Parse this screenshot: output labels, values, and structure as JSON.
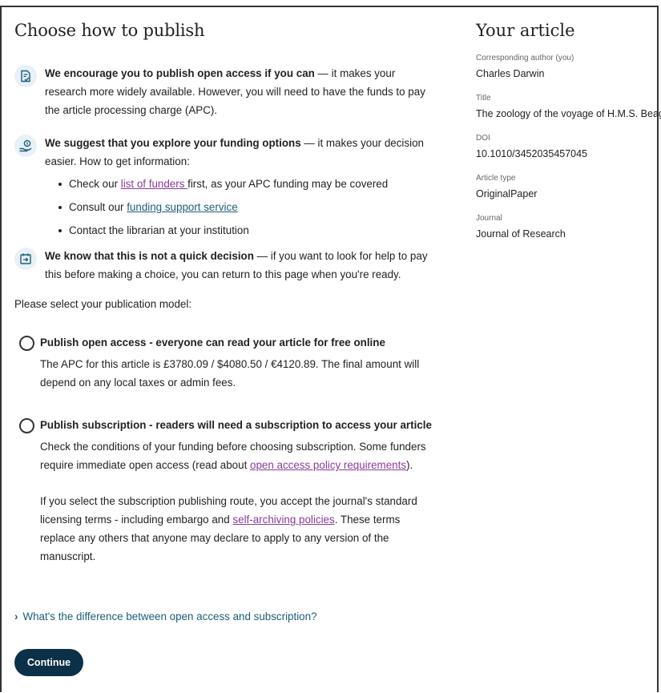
{
  "main": {
    "title": "Choose how to publish",
    "info": [
      {
        "icon": "document-check-icon",
        "bold": "We encourage you to publish open access if you can",
        "rest": " — it makes your research more widely available. However, you will need to have the funds to pay the article processing charge (APC)."
      },
      {
        "icon": "funding-hand-icon",
        "bold": "We suggest that you explore your funding options",
        "rest": " — it makes your decision easier. How to get information:",
        "bullets": {
          "b1_pre": "Check our ",
          "b1_link": "list of funders ",
          "b1_post": "first, as your APC funding may be covered",
          "b2_pre": "Consult our ",
          "b2_link": "funding support service",
          "b3": "Contact the librarian at your institution"
        }
      },
      {
        "icon": "calendar-arrow-icon",
        "bold": "We know that this is not a quick decision",
        "rest": " — if you want to look for help to pay this before making a choice, you can return to this page when you're ready."
      }
    ],
    "prompt": "Please select your publication model:",
    "options": {
      "open_access": {
        "label": "Publish open access - everyone can read your article for free online",
        "desc": "The APC for this article is £3780.09 / $4080.50 / €4120.89. The final amount will depend on any local taxes or admin fees."
      },
      "subscription": {
        "label": "Publish subscription - readers will need a subscription to access your article",
        "p1_pre": "Check the conditions of your funding before choosing subscription. Some funders require immediate open access (read about ",
        "p1_link": "open access policy requirements",
        "p1_post": ").",
        "p2_pre": "If you select the subscription publishing route, you accept the journal's standard licensing terms - including embargo and ",
        "p2_link": "self-archiving policies",
        "p2_post": ". These terms replace any others that anyone may declare to apply to any version of the manuscript."
      }
    },
    "difference_toggle": "What's the difference between open access and subscription?",
    "continue_label": "Continue"
  },
  "sidebar": {
    "title": "Your article",
    "fields": [
      {
        "label": "Corresponding author (you)",
        "value": "Charles Darwin"
      },
      {
        "label": "Title",
        "value": "The zoology of the voyage of H.M.S. Beagle"
      },
      {
        "label": "DOI",
        "value": "10.1010/3452035457045"
      },
      {
        "label": "Article type",
        "value": "OriginalPaper"
      },
      {
        "label": "Journal",
        "value": "Journal of Research"
      }
    ]
  },
  "colors": {
    "accent": "#0b3047",
    "link_purple": "#8a3a9c",
    "link_blue": "#1c5d7a",
    "icon_bg": "#e7f1f7"
  }
}
